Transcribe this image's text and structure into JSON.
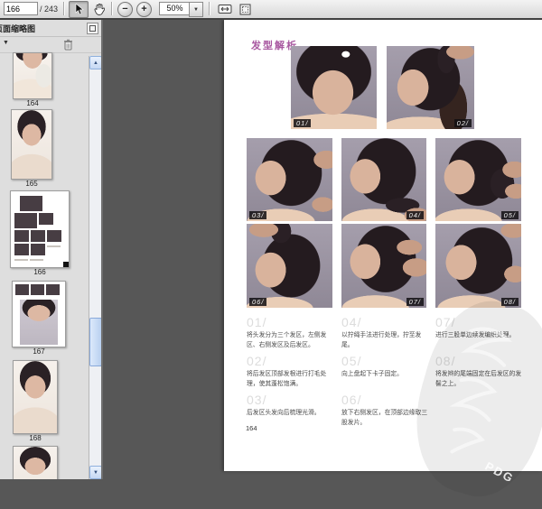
{
  "toolbar": {
    "page_input": "166",
    "page_total": "/ 243",
    "zoom_out_glyph": "−",
    "zoom_in_glyph": "+",
    "zoom_level": "50%",
    "zoom_dropdown_glyph": "▼"
  },
  "sidebar": {
    "title": "页面缩略图",
    "menu_caret": "▼",
    "scroll_up_glyph": "▲",
    "scroll_down_glyph": "▼",
    "thumbnails": [
      {
        "label": "164"
      },
      {
        "label": "165"
      },
      {
        "label": "166",
        "selected": true
      },
      {
        "label": "167"
      },
      {
        "label": "168"
      },
      {
        "label": ""
      }
    ]
  },
  "page": {
    "title": "发型解析",
    "page_number": "164",
    "watermark": "PDG",
    "photos": [
      {
        "label": "01/"
      },
      {
        "label": "02/"
      },
      {
        "label": "03/"
      },
      {
        "label": "04/"
      },
      {
        "label": "05/"
      },
      {
        "label": "06/"
      },
      {
        "label": "07/"
      },
      {
        "label": "08/"
      }
    ],
    "steps": [
      {
        "num": "01/",
        "text": "将头发分为三个发区，左侧发区、右侧发区及后发区。"
      },
      {
        "num": "02/",
        "text": "将后发区顶部发根进行打毛处理，使其蓬松饱满。"
      },
      {
        "num": "03/",
        "text": "后发区头发向后梳理光滑。"
      },
      {
        "num": "04/",
        "text": "以拧绳手法进行处理，拧至发尾。"
      },
      {
        "num": "05/",
        "text": "向上盘起下卡子固定。"
      },
      {
        "num": "06/",
        "text": "放下右侧发区，在顶部边缘取三股发片。"
      },
      {
        "num": "07/",
        "text": "进行三股单边续发编织处理。"
      },
      {
        "num": "08/",
        "text": "将发辫的尾端固定在后发区的发髻之上。"
      }
    ]
  }
}
